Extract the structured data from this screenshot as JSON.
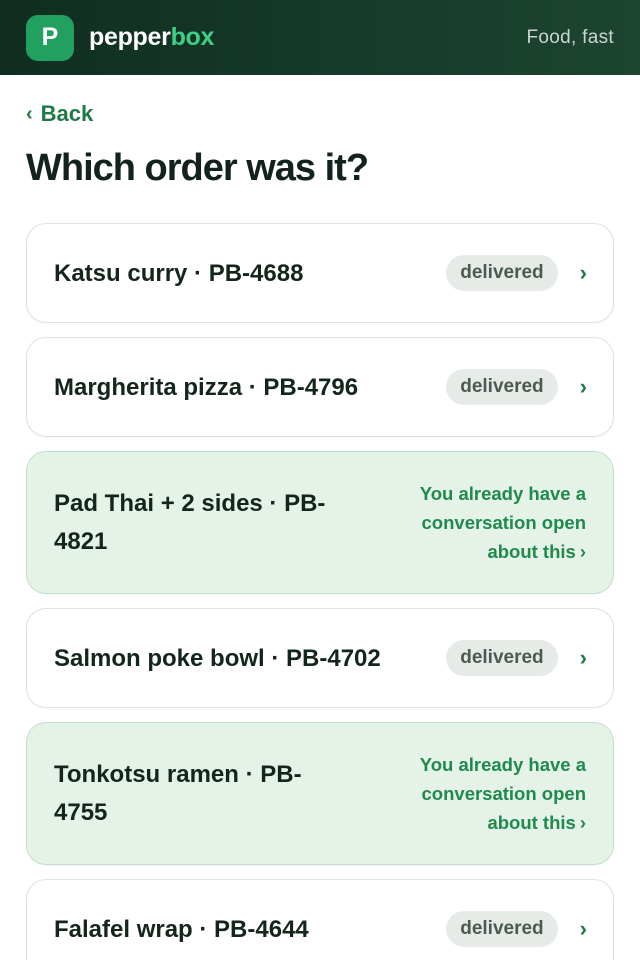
{
  "header": {
    "logo_letter": "P",
    "brand_part1": "pepper",
    "brand_part2": "box",
    "tagline": "Food, fast"
  },
  "nav": {
    "back_label": "Back",
    "back_chevron": "‹"
  },
  "page": {
    "title": "Which order was it?"
  },
  "orders": [
    {
      "title": "Katsu curry · PB-4688",
      "status": "delivered"
    },
    {
      "title": "Margherita pizza · PB-4796",
      "status": "delivered"
    },
    {
      "title": "Pad Thai + 2 sides · PB-4821",
      "open_note": "You already have a conversation open about this"
    },
    {
      "title": "Salmon poke bowl · PB-4702",
      "status": "delivered"
    },
    {
      "title": "Tonkotsu ramen · PB-4755",
      "open_note": "You already have a conversation open about this"
    },
    {
      "title": "Falafel wrap · PB-4644",
      "status": "delivered"
    }
  ],
  "icons": {
    "chevron": "›"
  },
  "colors": {
    "header_bg": "#0f2e20",
    "accent_green": "#22a05f",
    "brand_highlight": "#3fcf84",
    "link_green": "#1f7a48",
    "open_card_bg": "#e4f2e8",
    "badge_bg": "#e6ebe8"
  }
}
